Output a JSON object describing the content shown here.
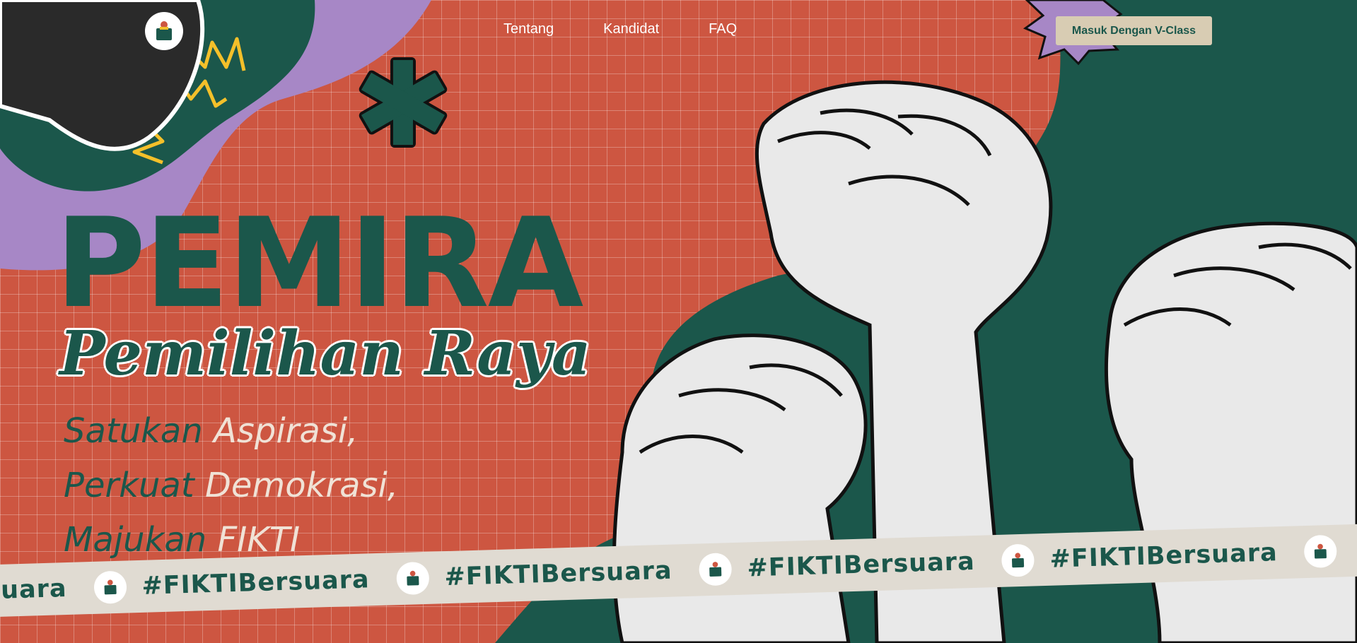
{
  "nav": {
    "links": [
      {
        "label": "Tentang"
      },
      {
        "label": "Kandidat"
      },
      {
        "label": "FAQ"
      }
    ],
    "login_label": "Masuk Dengan V-Class"
  },
  "hero": {
    "title": "PEMIRA",
    "subtitle": "Pemilihan Raya",
    "tagline": [
      {
        "a": "Satukan",
        "b": "Aspirasi,"
      },
      {
        "a": "Perkuat",
        "b": "Demokrasi,"
      },
      {
        "a": "Majukan",
        "b": "FIKTI"
      }
    ]
  },
  "ribbon": {
    "lead": "rsuara",
    "hashtag": "#FIKTIBersuara"
  },
  "colors": {
    "background": "#cd5641",
    "green": "#1b574b",
    "purple": "#a787c6",
    "yellow": "#f4c02a",
    "cream": "#d8ccb3",
    "ribbon": "#e0dbd2"
  }
}
